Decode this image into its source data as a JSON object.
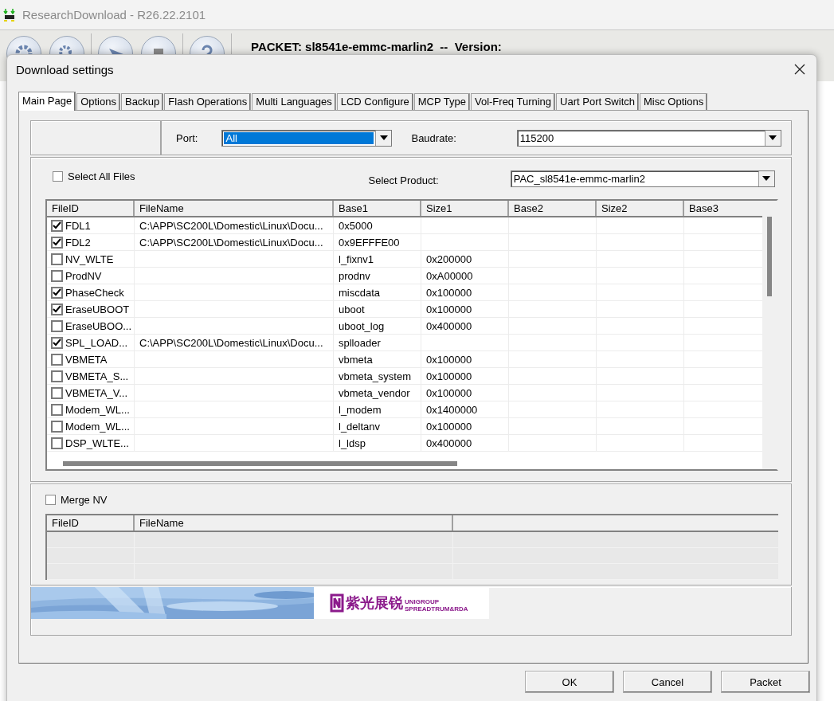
{
  "app": {
    "title": "ResearchDownload - R26.22.2101",
    "packet_label": "PACKET: sl8541e-emmc-marlin2  --  Version:"
  },
  "dialog": {
    "title": "Download settings",
    "tabs": [
      {
        "label": "Main Page",
        "selected": true
      },
      {
        "label": "Options",
        "selected": false
      },
      {
        "label": "Backup",
        "selected": false
      },
      {
        "label": "Flash Operations",
        "selected": false
      },
      {
        "label": "Multi Languages",
        "selected": false
      },
      {
        "label": "LCD Configure",
        "selected": false
      },
      {
        "label": "MCP Type",
        "selected": false
      },
      {
        "label": "Vol-Freq Turning",
        "selected": false
      },
      {
        "label": "Uart Port Switch",
        "selected": false
      },
      {
        "label": "Misc Options",
        "selected": false
      }
    ],
    "port": {
      "label": "Port:",
      "value": "All"
    },
    "baudrate": {
      "label": "Baudrate:",
      "value": "115200"
    },
    "select_all": {
      "label": "Select All Files",
      "checked": false
    },
    "product": {
      "label": "Select Product:",
      "value": "PAC_sl8541e-emmc-marlin2"
    },
    "table": {
      "columns": [
        "FileID",
        "FileName",
        "Base1",
        "Size1",
        "Base2",
        "Size2",
        "Base3"
      ],
      "rows": [
        {
          "checked": true,
          "file_id": "FDL1",
          "file_name": "C:\\APP\\SC200L\\Domestic\\Linux\\Docu...",
          "base1": "0x5000",
          "size1": ""
        },
        {
          "checked": true,
          "file_id": "FDL2",
          "file_name": "C:\\APP\\SC200L\\Domestic\\Linux\\Docu...",
          "base1": "0x9EFFFE00",
          "size1": ""
        },
        {
          "checked": false,
          "file_id": "NV_WLTE",
          "file_name": "",
          "base1": "l_fixnv1",
          "size1": "0x200000"
        },
        {
          "checked": false,
          "file_id": "ProdNV",
          "file_name": "",
          "base1": "prodnv",
          "size1": "0xA00000"
        },
        {
          "checked": true,
          "file_id": "PhaseCheck",
          "file_name": "",
          "base1": "miscdata",
          "size1": "0x100000"
        },
        {
          "checked": true,
          "file_id": "EraseUBOOT",
          "file_name": "",
          "base1": "uboot",
          "size1": "0x100000"
        },
        {
          "checked": false,
          "file_id": "EraseUBOO...",
          "file_name": "",
          "base1": "uboot_log",
          "size1": "0x400000"
        },
        {
          "checked": true,
          "file_id": "SPL_LOAD...",
          "file_name": "C:\\APP\\SC200L\\Domestic\\Linux\\Docu...",
          "base1": "splloader",
          "size1": ""
        },
        {
          "checked": false,
          "file_id": "VBMETA",
          "file_name": "",
          "base1": "vbmeta",
          "size1": "0x100000"
        },
        {
          "checked": false,
          "file_id": "VBMETA_S...",
          "file_name": "",
          "base1": "vbmeta_system",
          "size1": "0x100000"
        },
        {
          "checked": false,
          "file_id": "VBMETA_V...",
          "file_name": "",
          "base1": "vbmeta_vendor",
          "size1": "0x100000"
        },
        {
          "checked": false,
          "file_id": "Modem_WL...",
          "file_name": "",
          "base1": "l_modem",
          "size1": "0x1400000"
        },
        {
          "checked": false,
          "file_id": "Modem_WL...",
          "file_name": "",
          "base1": "l_deltanv",
          "size1": "0x100000"
        },
        {
          "checked": false,
          "file_id": "DSP_WLTE...",
          "file_name": "",
          "base1": "l_ldsp",
          "size1": "0x400000"
        }
      ]
    },
    "merge_nv": {
      "label": "Merge NV",
      "checked": false,
      "columns": [
        "FileID",
        "FileName"
      ]
    },
    "banner": {
      "logo": "紫光展锐",
      "logo_small_1": "UNIGROUP",
      "logo_small_2": "SPREADTRUM&RDA"
    },
    "buttons": [
      "OK",
      "Cancel",
      "Packet"
    ]
  }
}
